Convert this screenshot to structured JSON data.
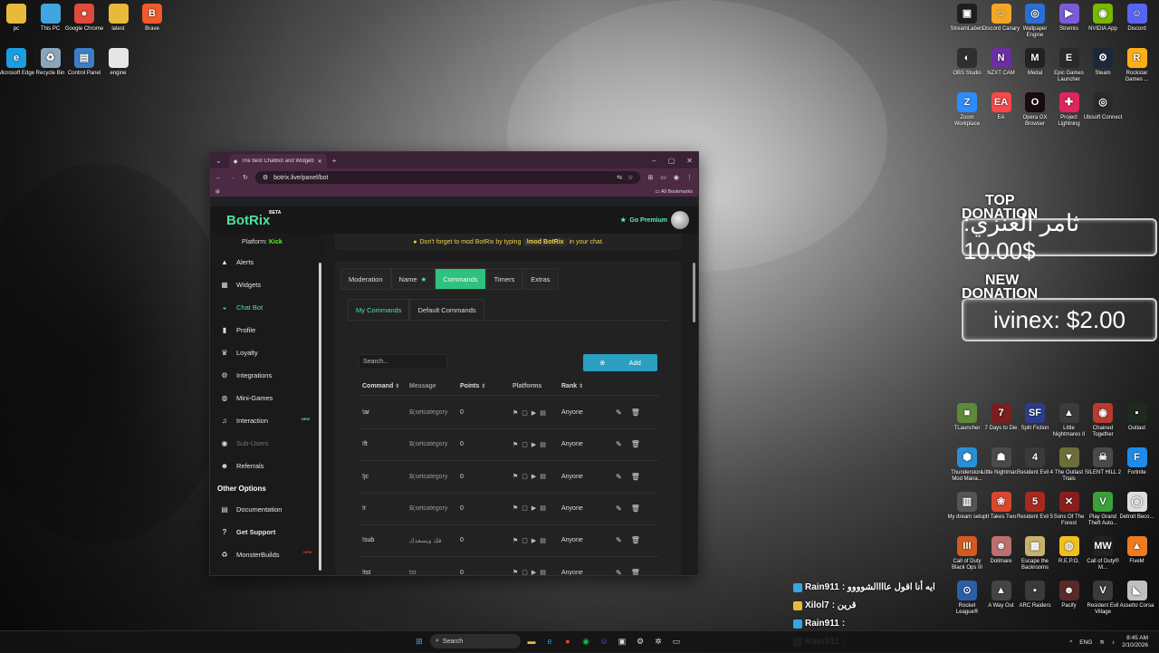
{
  "desktop_left": [
    {
      "label": "pc",
      "icon": "folder-icon",
      "color": "#e8b93b",
      "glyph": ""
    },
    {
      "label": "This PC",
      "icon": "monitor-icon",
      "color": "#3ea6e0",
      "glyph": ""
    },
    {
      "label": "Google Chrome",
      "icon": "chrome-icon",
      "color": "#e04a3a",
      "glyph": "●"
    },
    {
      "label": "latest",
      "icon": "folder-icon",
      "color": "#e8b93b",
      "glyph": ""
    },
    {
      "label": "Brave",
      "icon": "brave-icon",
      "color": "#f15a29",
      "glyph": "B"
    },
    {
      "label": "Microsoft Edge",
      "icon": "edge-icon",
      "color": "#1b9de2",
      "glyph": "e"
    },
    {
      "label": "Recycle Bin",
      "icon": "recycle-bin-icon",
      "color": "#8aa6b8",
      "glyph": "♻"
    },
    {
      "label": "Control Panel",
      "icon": "control-panel-icon",
      "color": "#3c7fc9",
      "glyph": "▤"
    },
    {
      "label": "engine",
      "icon": "file-icon",
      "color": "#e6e6e6",
      "glyph": ""
    }
  ],
  "desktop_right_top": [
    {
      "label": "StreamLabels",
      "icon": "streamlabels-icon",
      "color": "#1e1e1e",
      "glyph": "▣"
    },
    {
      "label": "Discord Canary",
      "icon": "discord-canary-icon",
      "color": "#f5a623",
      "glyph": "☺"
    },
    {
      "label": "Wallpaper Engine",
      "icon": "wallpaper-engine-icon",
      "color": "#2a6fd6",
      "glyph": "◎"
    },
    {
      "label": "Stremio",
      "icon": "stremio-icon",
      "color": "#7b5cd6",
      "glyph": "▶"
    },
    {
      "label": "NVIDIA App",
      "icon": "nvidia-icon",
      "color": "#76b900",
      "glyph": "◉"
    },
    {
      "label": "Discord",
      "icon": "discord-icon",
      "color": "#5865f2",
      "glyph": "☺"
    },
    {
      "label": "OBS Studio",
      "icon": "obs-icon",
      "color": "#302e31",
      "glyph": "◐"
    },
    {
      "label": "NZXT CAM",
      "icon": "nzxt-icon",
      "color": "#6b2fa3",
      "glyph": "N"
    },
    {
      "label": "Medal",
      "icon": "medal-icon",
      "color": "#222222",
      "glyph": "M"
    },
    {
      "label": "Epic Games Launcher",
      "icon": "epic-games-icon",
      "color": "#2a2a2a",
      "glyph": "E"
    },
    {
      "label": "Steam",
      "icon": "steam-icon",
      "color": "#1b2838",
      "glyph": "⚙"
    },
    {
      "label": "Rockstar Games ...",
      "icon": "rockstar-icon",
      "color": "#fcaf17",
      "glyph": "R"
    },
    {
      "label": "Zoom Workplace",
      "icon": "zoom-icon",
      "color": "#2d8cff",
      "glyph": "Z"
    },
    {
      "label": "EA",
      "icon": "ea-icon",
      "color": "#ff4747",
      "glyph": "EA"
    },
    {
      "label": "Opera GX Browser",
      "icon": "opera-gx-icon",
      "color": "#1a0a12",
      "glyph": "O"
    },
    {
      "label": "Project Lightning",
      "icon": "project-lightning-icon",
      "color": "#e0245e",
      "glyph": "✚"
    },
    {
      "label": "Ubisoft Connect",
      "icon": "ubisoft-icon",
      "color": "#2a2a2a",
      "glyph": "◎"
    }
  ],
  "desktop_right_bottom": [
    {
      "label": "TLauncher",
      "icon": "tlauncher-icon",
      "color": "#5d8a3a",
      "glyph": "■"
    },
    {
      "label": "7 Days to Die",
      "icon": "7-days-icon",
      "color": "#7a1e1e",
      "glyph": "7"
    },
    {
      "label": "Split Fiction",
      "icon": "split-fiction-icon",
      "color": "#2a3d8f",
      "glyph": "SF"
    },
    {
      "label": "Little Nightmares II",
      "icon": "little-nightmares-2-icon",
      "color": "#3b3b3b",
      "glyph": "▲"
    },
    {
      "label": "Chained Together",
      "icon": "chained-together-icon",
      "color": "#b83b2e",
      "glyph": "◉"
    },
    {
      "label": "Outlast",
      "icon": "outlast-icon",
      "color": "#1f2a1f",
      "glyph": "▪"
    },
    {
      "label": "Thunderstore Mod Mana...",
      "icon": "thunderstore-icon",
      "color": "#2a8fd6",
      "glyph": "⬢"
    },
    {
      "label": "Little Nightmar...",
      "icon": "little-nightmares-icon",
      "color": "#4a4a4a",
      "glyph": "☗"
    },
    {
      "label": "Resident Evil 4",
      "icon": "resident-evil-4-icon",
      "color": "#3a3a3a",
      "glyph": "4"
    },
    {
      "label": "The Outlast Trials",
      "icon": "outlast-trials-icon",
      "color": "#6d6d3a",
      "glyph": "▼"
    },
    {
      "label": "SILENT HILL 2",
      "icon": "silent-hill-icon",
      "color": "#4a4a4a",
      "glyph": "☠"
    },
    {
      "label": "Fortnite",
      "icon": "fortnite-icon",
      "color": "#1e8ce8",
      "glyph": "F"
    },
    {
      "label": "My dream setup",
      "icon": "my-dream-setup-icon",
      "color": "#555555",
      "glyph": "▥"
    },
    {
      "label": "It Takes Two",
      "icon": "it-takes-two-icon",
      "color": "#d9482e",
      "glyph": "❀"
    },
    {
      "label": "Resident Evil 5",
      "icon": "resident-evil-5-icon",
      "color": "#a82a1e",
      "glyph": "5"
    },
    {
      "label": "Sons Of The Forest",
      "icon": "sons-of-the-forest-icon",
      "color": "#8a1e1e",
      "glyph": "✕"
    },
    {
      "label": "Play Grand Theft Auto...",
      "icon": "gta-icon",
      "color": "#3aa13a",
      "glyph": "V"
    },
    {
      "label": "Detroit Beco...",
      "icon": "detroit-icon",
      "color": "#dddddd",
      "glyph": "◯"
    },
    {
      "label": "Call of Duty Black Ops III",
      "icon": "cod-bo3-icon",
      "color": "#d45a1e",
      "glyph": "III"
    },
    {
      "label": "Dollmare",
      "icon": "dollmare-icon",
      "color": "#bb6f6f",
      "glyph": "☻"
    },
    {
      "label": "Escape the Backrooms",
      "icon": "escape-backrooms-icon",
      "color": "#c9b36b",
      "glyph": "▦"
    },
    {
      "label": "R.E.P.O.",
      "icon": "repo-icon",
      "color": "#f0c020",
      "glyph": "◍"
    },
    {
      "label": "Call of Duty® M...",
      "icon": "cod-mw-icon",
      "color": "#222222",
      "glyph": "MW"
    },
    {
      "label": "FiveM",
      "icon": "fivem-icon",
      "color": "#f07a1e",
      "glyph": "▲"
    },
    {
      "label": "Rocket League®",
      "icon": "rocket-league-icon",
      "color": "#2a5fa8",
      "glyph": "⊙"
    },
    {
      "label": "A Way Out",
      "icon": "a-way-out-icon",
      "color": "#444444",
      "glyph": "▲"
    },
    {
      "label": "ARC Raiders",
      "icon": "arc-raiders-icon",
      "color": "#3a3a3a",
      "glyph": "▪"
    },
    {
      "label": "Pacify",
      "icon": "pacify-icon",
      "color": "#5a2a2a",
      "glyph": "☻"
    },
    {
      "label": "Resident Evil Village",
      "icon": "re-village-icon",
      "color": "#3a3a3a",
      "glyph": "V"
    },
    {
      "label": "Assetto Corsa",
      "icon": "assetto-corsa-icon",
      "color": "#c0c0c0",
      "glyph": "◣"
    }
  ],
  "browser": {
    "tab_title": "The best ChatBot and Widgets",
    "url": "botrix.live/panel/bot",
    "bookmarks": "All Bookmarks",
    "window_controls": [
      "–",
      "▢",
      "✕"
    ]
  },
  "app": {
    "logo": "BotRix",
    "logo_badge": "BETA",
    "premium": "Go Premium",
    "platform_label": "Platform:",
    "platform_value": "Kick",
    "notice_pre": "Don't forget to mod BotRix by typing",
    "notice_cmd": "/mod BotRix",
    "notice_post": "in your chat."
  },
  "sidebar": [
    {
      "label": "Alerts",
      "icon": "alert-icon",
      "glyph": "▲",
      "state": ""
    },
    {
      "label": "Widgets",
      "icon": "widgets-icon",
      "glyph": "▦",
      "state": ""
    },
    {
      "label": "Chat Bot",
      "icon": "robot-icon",
      "glyph": "◒",
      "state": "active"
    },
    {
      "label": "Profile",
      "icon": "profile-icon",
      "glyph": "▮",
      "state": ""
    },
    {
      "label": "Loyalty",
      "icon": "trophy-icon",
      "glyph": "♛",
      "state": ""
    },
    {
      "label": "Integrations",
      "icon": "integrations-icon",
      "glyph": "⚙",
      "state": ""
    },
    {
      "label": "Mini-Games",
      "icon": "gamepad-icon",
      "glyph": "◍",
      "state": ""
    },
    {
      "label": "Interaction",
      "icon": "music-icon",
      "glyph": "♫",
      "state": "",
      "badge": "NEW"
    },
    {
      "label": "Sub-Users",
      "icon": "sub-users-icon",
      "glyph": "◉",
      "state": "disabled"
    },
    {
      "label": "Referrals",
      "icon": "referrals-icon",
      "glyph": "☻",
      "state": ""
    }
  ],
  "sidebar_other": {
    "heading": "Other Options",
    "items": [
      {
        "label": "Documentation",
        "icon": "book-icon",
        "glyph": "▤"
      },
      {
        "label": "Get Support",
        "icon": "help-icon",
        "glyph": "?"
      },
      {
        "label": "MonsterBuilds",
        "icon": "monsterbuilds-icon",
        "glyph": "♻",
        "badge": "NEW"
      }
    ]
  },
  "tabs": [
    "Moderation",
    "Name",
    "Commands",
    "Timers",
    "Extras"
  ],
  "active_tab": "Commands",
  "subtabs": [
    "My Commands",
    "Default Commands"
  ],
  "search_placeholder": "Search...",
  "add_label": "Add",
  "columns": [
    "Command",
    "Message",
    "Points",
    "Platforms",
    "Rank"
  ],
  "commands": [
    {
      "command": "!ar",
      "message": "$(setcategory",
      "points": "0",
      "rank": "Anyone"
    },
    {
      "command": "!ft",
      "message": "$(setcategory",
      "points": "0",
      "rank": "Anyone"
    },
    {
      "command": "!jc",
      "message": "$(setcategory",
      "points": "0",
      "rank": "Anyone"
    },
    {
      "command": "!r",
      "message": "$(setcategory",
      "points": "0",
      "rank": "Anyone"
    },
    {
      "command": "!sub",
      "message": "فك ويسعدك",
      "points": "0",
      "rank": "Anyone"
    },
    {
      "command": "!tst",
      "message": "tst",
      "points": "0",
      "rank": "Anyone"
    }
  ],
  "overlay": {
    "top_label_1": "TOP",
    "top_label_2": "DONATION",
    "top_value": "ثامر العنزي: 10.00$",
    "new_label_1": "NEW",
    "new_label_2": "DONATION",
    "new_value": "ivinex: $2.00"
  },
  "chat": [
    {
      "user": "Rain911",
      "text": ": ايه أنا اقول عاااالشوووو",
      "badge_color": "#3aa6e0"
    },
    {
      "user": "Xilol7",
      "text": ": قرين",
      "badge_color": "#e8b93b"
    },
    {
      "user": "Rain911",
      "text": ":",
      "badge_color": "#3aa6e0"
    },
    {
      "user": "Rain911",
      "text": ":",
      "badge_color": "#3aa6e0"
    }
  ],
  "taskbar": {
    "search": "Search",
    "lang": "ENG",
    "time": "8:45 AM",
    "date": "2/10/2026"
  }
}
